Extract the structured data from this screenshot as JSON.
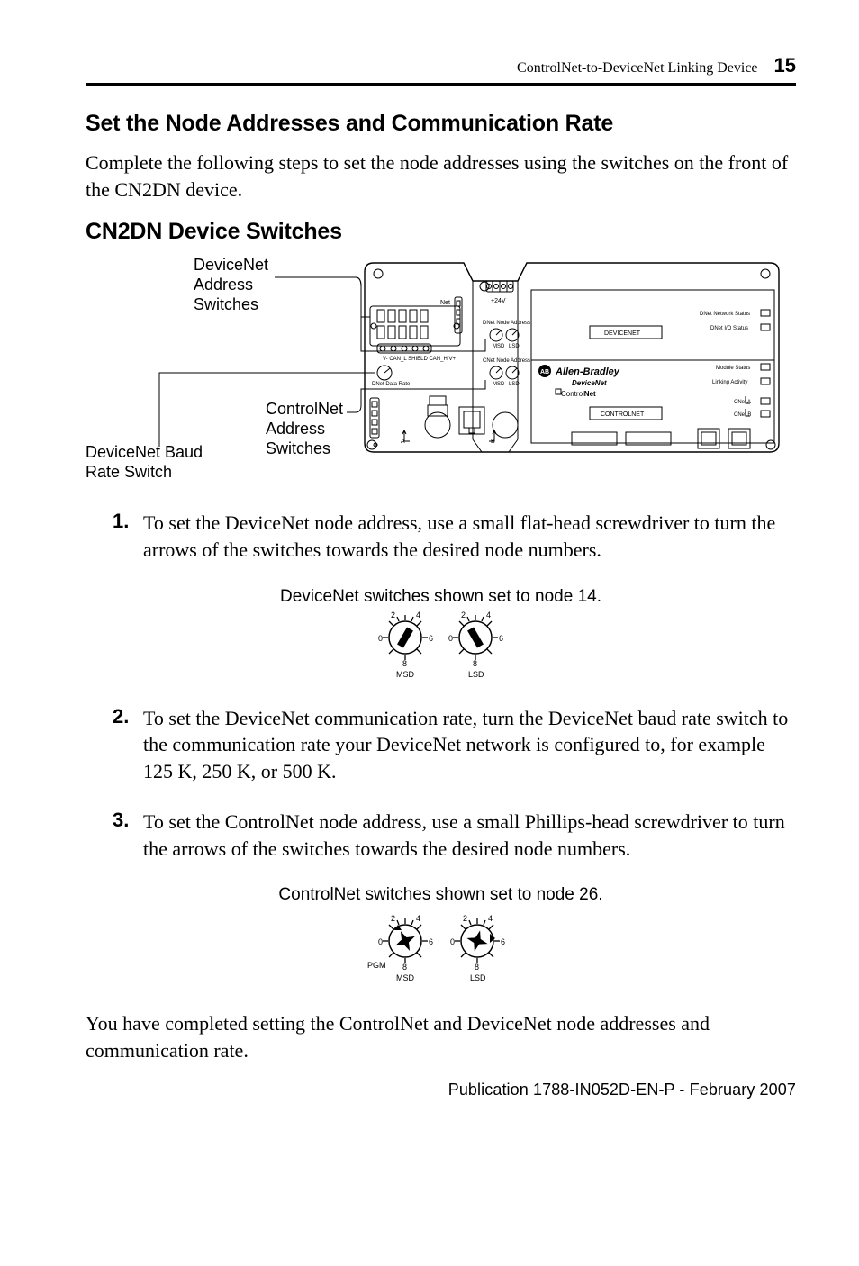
{
  "header": {
    "title": "ControlNet-to-DeviceNet Linking Device",
    "page": "15"
  },
  "section": {
    "title": "Set the Node Addresses and Communication Rate",
    "intro": "Complete the following steps to set the node addresses using the switches on the front of the CN2DN device."
  },
  "figure1": {
    "title": "CN2DN Device Switches",
    "labels": {
      "dnet_addr": "DeviceNet\nAddress\nSwitches",
      "baud": "DeviceNet Baud\nRate Switch",
      "cnet_addr": "ControlNet\nAddress\nSwitches",
      "v24": "+24V",
      "net": "Net",
      "devicenet_box": "DEVICENET",
      "controlnet_box": "CONTROLNET",
      "ab_logo": "AB",
      "ab_name": "Allen-Bradley",
      "ab_dnet": "DeviceNet",
      "ab_cnet": "ControlNet",
      "stat_dnet_net": "DNet Network Status",
      "stat_dnet_io": "DNet I/O Status",
      "stat_module": "Module Status",
      "stat_link": "Linking Activity",
      "stat_cneta": "CNet A",
      "stat_cnetb": "CNet B",
      "a": "A",
      "b": "B",
      "msd": "MSD",
      "lsd": "LSD"
    }
  },
  "steps": [
    {
      "num": "1.",
      "text": "To set the DeviceNet node address, use a small flat-head screwdriver to turn the arrows of the switches towards the desired node numbers."
    },
    {
      "num": "2.",
      "text": "To set the DeviceNet communication rate, turn the DeviceNet baud rate switch to the communication rate your DeviceNet network is configured to, for example 125 K, 250 K, or 500 K."
    },
    {
      "num": "3.",
      "text": "To set the ControlNet node address, use a small Phillips-head screwdriver to turn the arrows of the switches towards the desired node numbers."
    }
  ],
  "caption1": "DeviceNet switches shown set to node 14.",
  "caption2": "ControlNet switches shown set to node 26.",
  "dial": {
    "d0": "0",
    "d2": "2",
    "d4": "4",
    "d6": "6",
    "d8": "8",
    "msd": "MSD",
    "lsd": "LSD",
    "pgm": "PGM"
  },
  "closing": "You have completed setting the ControlNet and DeviceNet node addresses and communication rate.",
  "footer": "Publication  1788-IN052D-EN-P - February 2007"
}
